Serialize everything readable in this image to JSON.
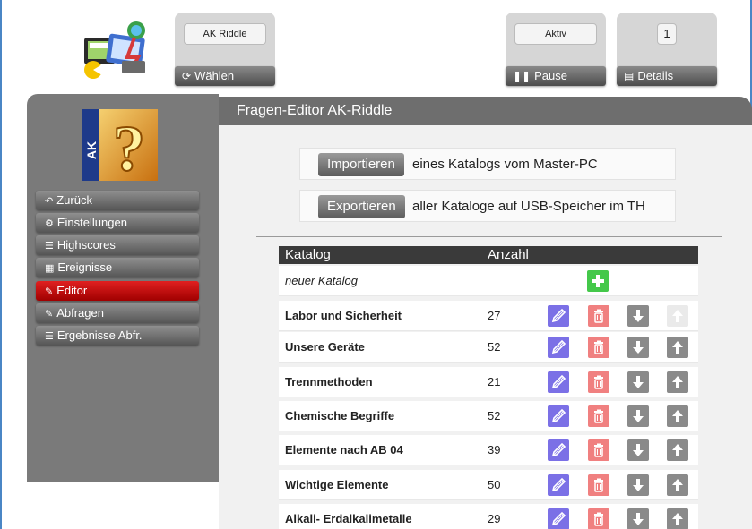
{
  "window": {
    "title": "AK Riddle"
  },
  "top": {
    "app_field": "AK Riddle",
    "select_label": "Wählen",
    "status_field": "Aktiv",
    "pause_label": "Pause",
    "count_field": "1",
    "details_label": "Details"
  },
  "sidebar": {
    "items": [
      {
        "label": "Zurück",
        "icon": "undo-icon"
      },
      {
        "label": "Einstellungen",
        "icon": "gear-icon"
      },
      {
        "label": "Highscores",
        "icon": "list-icon"
      },
      {
        "label": "Ereignisse",
        "icon": "calendar-icon"
      },
      {
        "label": "Editor",
        "icon": "edit-icon",
        "active": true
      },
      {
        "label": "Abfragen",
        "icon": "edit-icon"
      },
      {
        "label": "Ergebnisse Abfr.",
        "icon": "list-icon"
      }
    ]
  },
  "main": {
    "title": "Fragen-Editor AK-Riddle",
    "import_label": "Importieren",
    "import_text": "eines Katalogs vom Master-PC",
    "export_label": "Exportieren",
    "export_text": "aller Kataloge auf USB-Speicher im TH",
    "table": {
      "headers": [
        "Katalog",
        "Anzahl"
      ],
      "new_row": "neuer Katalog",
      "rows": [
        {
          "name": "Labor und Sicherheit",
          "count": "27",
          "up_disabled": true
        },
        {
          "name": "Unsere Geräte",
          "count": "52"
        },
        {
          "name": "Trennmethoden",
          "count": "21"
        },
        {
          "name": "Chemische Begriffe",
          "count": "52"
        },
        {
          "name": "Elemente nach AB 04",
          "count": "39"
        },
        {
          "name": "Wichtige Elemente",
          "count": "50"
        },
        {
          "name": "Alkali- Erdalkalimetalle",
          "count": "29"
        }
      ]
    }
  },
  "colors": {
    "accent_active": "#c81010",
    "edit": "#7b70e6",
    "delete": "#f08080",
    "add": "#44c84a",
    "frame": "#4a86c5"
  }
}
